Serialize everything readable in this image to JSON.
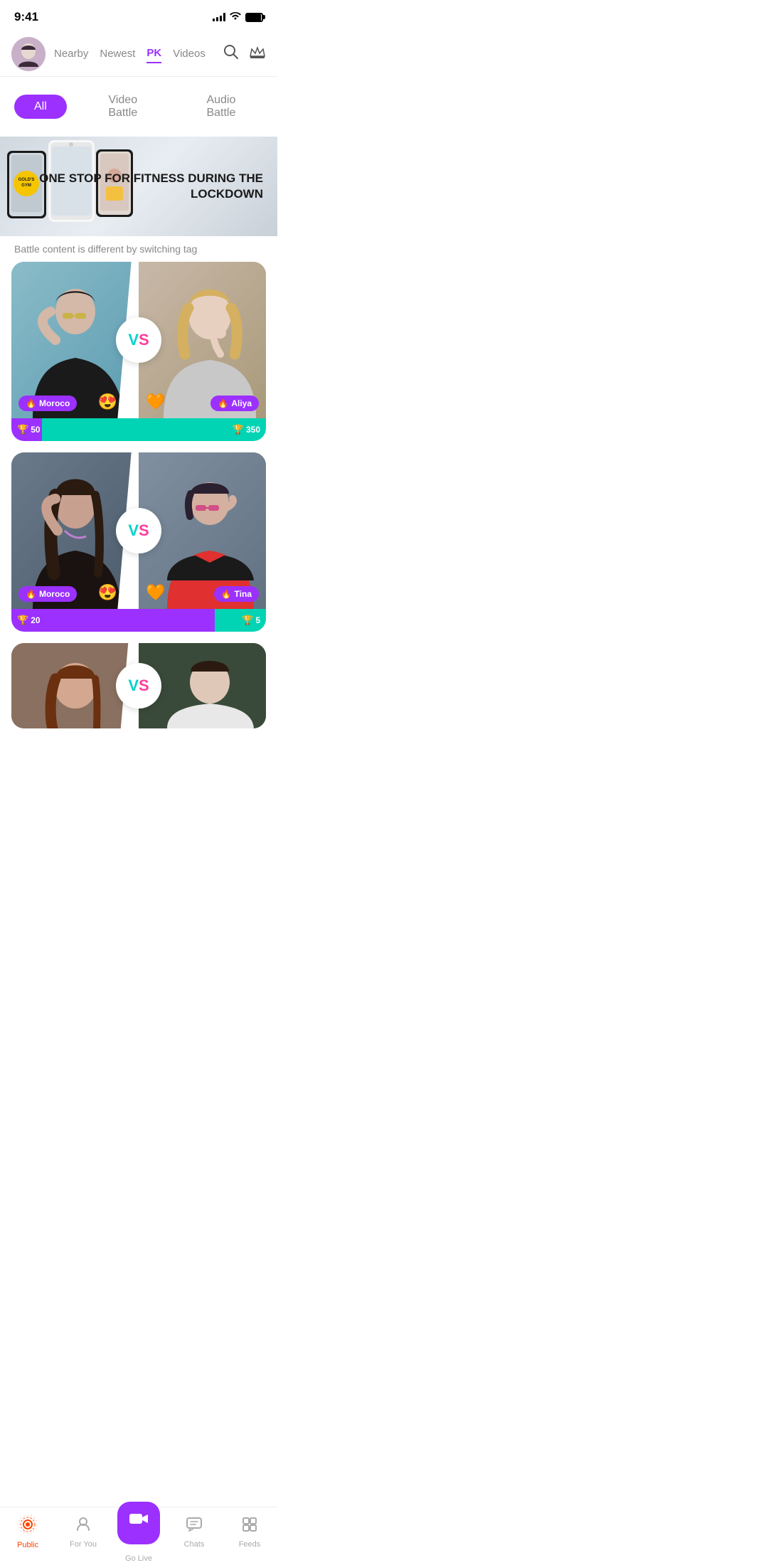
{
  "statusBar": {
    "time": "9:41"
  },
  "navHeader": {
    "tabs": [
      {
        "label": "Nearby",
        "active": false
      },
      {
        "label": "Newest",
        "active": false
      },
      {
        "label": "PK",
        "active": true
      },
      {
        "label": "Videos",
        "active": false
      }
    ]
  },
  "filterTabs": {
    "all": "All",
    "videoBattle": "Video Battle",
    "audioBattle": "Audio Battle"
  },
  "banner": {
    "text": "ONE STOP FOR FITNESS\nDURING THE LOCKDOWN",
    "gymLabel": "GOLD'S GYM"
  },
  "battleHint": "Battle content is different by switching tag",
  "battles": [
    {
      "leftFighter": "Moroco",
      "rightFighter": "Aliya",
      "leftScore": 50,
      "rightScore": 350,
      "leftPercent": 12,
      "rightPercent": 88,
      "leftEmoji": "😍",
      "rightEmoji": "🧡"
    },
    {
      "leftFighter": "Moroco",
      "rightFighter": "Tina",
      "leftScore": 20,
      "rightScore": 5,
      "leftPercent": 80,
      "rightPercent": 20,
      "leftEmoji": "😍",
      "rightEmoji": "🧡"
    }
  ],
  "bottomNav": {
    "items": [
      {
        "label": "Public",
        "icon": "📡",
        "active": true
      },
      {
        "label": "For You",
        "icon": "👤",
        "active": false
      },
      {
        "label": "Go Live",
        "icon": "📹",
        "active": false,
        "goLive": true
      },
      {
        "label": "Chats",
        "icon": "💬",
        "active": false
      },
      {
        "label": "Feeds",
        "icon": "📋",
        "active": false
      }
    ]
  },
  "colors": {
    "purple": "#9b30ff",
    "teal": "#00d4b4",
    "pink": "#ff3d9a",
    "red": "#ff4500"
  }
}
